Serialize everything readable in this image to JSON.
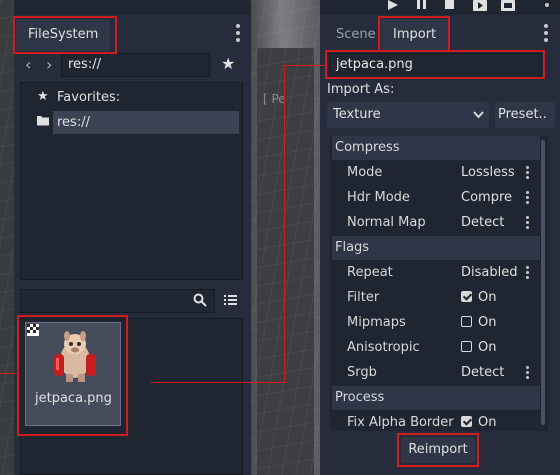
{
  "colors": {
    "accent_red": "#d01c1c",
    "dock_bg": "#262c3b",
    "panel_bg": "#1f2531"
  },
  "toolbar": {
    "icons": [
      "play-icon",
      "pause-icon",
      "stop-icon",
      "play-scene-icon",
      "play-custom-icon"
    ]
  },
  "filesystem": {
    "tab_label": "FileSystem",
    "path_value": "res://",
    "favorites_label": "Favorites:",
    "root_label": "res://",
    "file_name": "jetpaca.png"
  },
  "viewport": {
    "label": "[ Pe"
  },
  "import_dock": {
    "tabs": [
      "Scene",
      "Import"
    ],
    "file_name": "jetpaca.png",
    "import_as_label": "Import As:",
    "import_type": "Texture",
    "preset_label": "Preset..",
    "sections": {
      "compress": "Compress",
      "flags": "Flags",
      "process": "Process"
    },
    "properties": {
      "mode": {
        "label": "Mode",
        "value": "Lossless"
      },
      "hdr_mode": {
        "label": "Hdr Mode",
        "value": "Compre"
      },
      "normal_map": {
        "label": "Normal Map",
        "value": "Detect"
      },
      "repeat": {
        "label": "Repeat",
        "value": "Disabled"
      },
      "filter": {
        "label": "Filter",
        "value": "On",
        "checked": true
      },
      "mipmaps": {
        "label": "Mipmaps",
        "value": "On",
        "checked": false
      },
      "anisotropic": {
        "label": "Anisotropic",
        "value": "On",
        "checked": false
      },
      "srgb": {
        "label": "Srgb",
        "value": "Detect"
      },
      "fix_alpha_border": {
        "label": "Fix Alpha Border",
        "value": "On",
        "checked": true
      }
    },
    "reimport_label": "Reimport"
  }
}
